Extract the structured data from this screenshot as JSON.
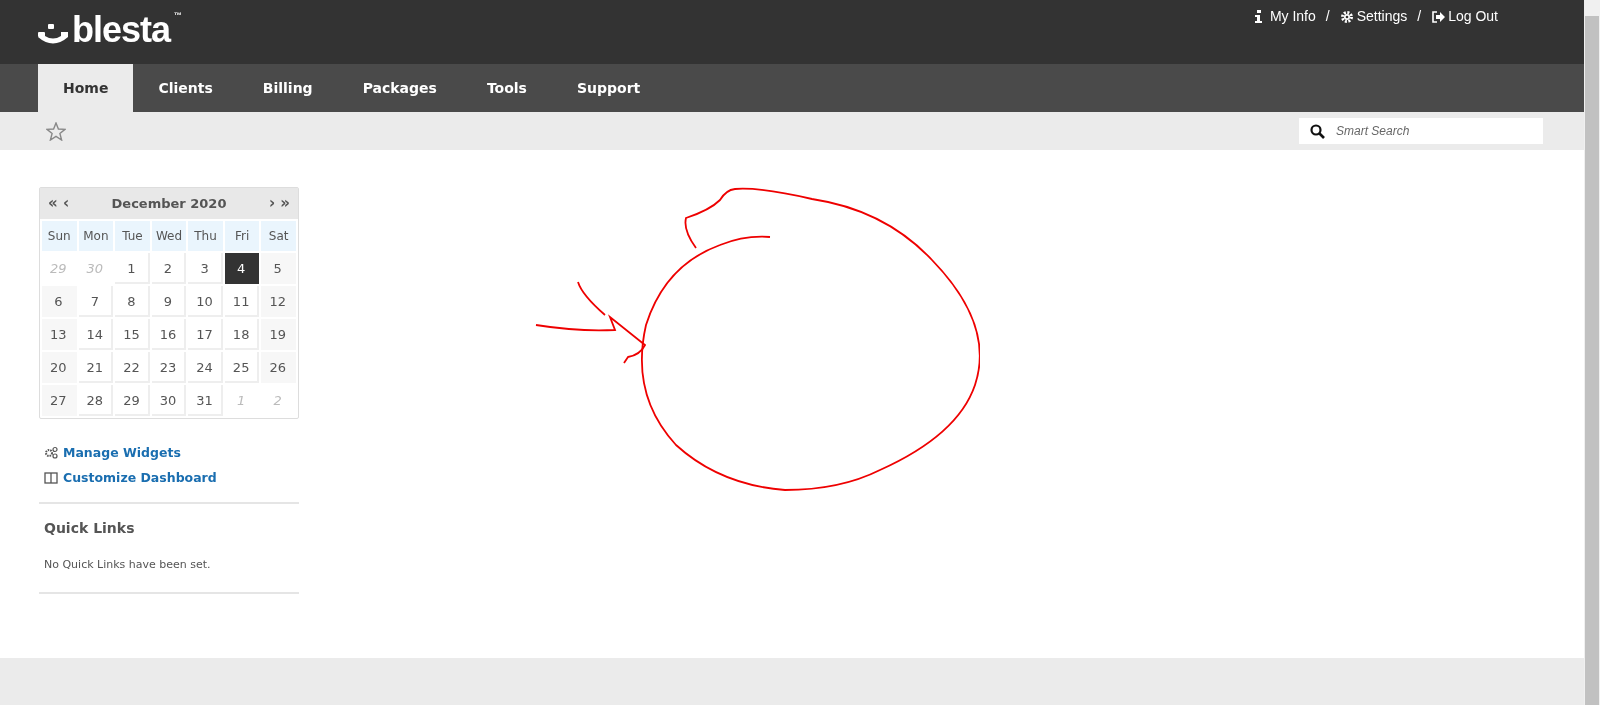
{
  "logo": {
    "text": "blesta",
    "trademark": "™"
  },
  "user_links": [
    {
      "kind": "info",
      "label": "My Info"
    },
    {
      "kind": "settings",
      "label": "Settings"
    },
    {
      "kind": "logout",
      "label": "Log Out"
    }
  ],
  "link_separator": "/",
  "nav_tabs": [
    {
      "label": "Home",
      "selected": true
    },
    {
      "label": "Clients",
      "selected": false
    },
    {
      "label": "Billing",
      "selected": false
    },
    {
      "label": "Packages",
      "selected": false
    },
    {
      "label": "Tools",
      "selected": false
    },
    {
      "label": "Support",
      "selected": false
    }
  ],
  "search": {
    "placeholder": "Smart Search"
  },
  "calendar": {
    "prev": "« ‹",
    "title": "December 2020",
    "next": "› »",
    "weekdays": [
      "Sun",
      "Mon",
      "Tue",
      "Wed",
      "Thu",
      "Fri",
      "Sat"
    ],
    "weeks": [
      [
        {
          "day": "29",
          "other_month": true,
          "selected": false
        },
        {
          "day": "30",
          "other_month": true,
          "selected": false
        },
        {
          "day": "1",
          "other_month": false,
          "selected": false
        },
        {
          "day": "2",
          "other_month": false,
          "selected": false
        },
        {
          "day": "3",
          "other_month": false,
          "selected": false
        },
        {
          "day": "4",
          "other_month": false,
          "selected": true
        },
        {
          "day": "5",
          "other_month": false,
          "selected": false
        }
      ],
      [
        {
          "day": "6",
          "other_month": false,
          "selected": false
        },
        {
          "day": "7",
          "other_month": false,
          "selected": false
        },
        {
          "day": "8",
          "other_month": false,
          "selected": false
        },
        {
          "day": "9",
          "other_month": false,
          "selected": false
        },
        {
          "day": "10",
          "other_month": false,
          "selected": false
        },
        {
          "day": "11",
          "other_month": false,
          "selected": false
        },
        {
          "day": "12",
          "other_month": false,
          "selected": false
        }
      ],
      [
        {
          "day": "13",
          "other_month": false,
          "selected": false
        },
        {
          "day": "14",
          "other_month": false,
          "selected": false
        },
        {
          "day": "15",
          "other_month": false,
          "selected": false
        },
        {
          "day": "16",
          "other_month": false,
          "selected": false
        },
        {
          "day": "17",
          "other_month": false,
          "selected": false
        },
        {
          "day": "18",
          "other_month": false,
          "selected": false
        },
        {
          "day": "19",
          "other_month": false,
          "selected": false
        }
      ],
      [
        {
          "day": "20",
          "other_month": false,
          "selected": false
        },
        {
          "day": "21",
          "other_month": false,
          "selected": false
        },
        {
          "day": "22",
          "other_month": false,
          "selected": false
        },
        {
          "day": "23",
          "other_month": false,
          "selected": false
        },
        {
          "day": "24",
          "other_month": false,
          "selected": false
        },
        {
          "day": "25",
          "other_month": false,
          "selected": false
        },
        {
          "day": "26",
          "other_month": false,
          "selected": false
        }
      ],
      [
        {
          "day": "27",
          "other_month": false,
          "selected": false
        },
        {
          "day": "28",
          "other_month": false,
          "selected": false
        },
        {
          "day": "29",
          "other_month": false,
          "selected": false
        },
        {
          "day": "30",
          "other_month": false,
          "selected": false
        },
        {
          "day": "31",
          "other_month": false,
          "selected": false
        },
        {
          "day": "1",
          "other_month": true,
          "selected": false
        },
        {
          "day": "2",
          "other_month": true,
          "selected": false
        }
      ]
    ]
  },
  "widget_links": [
    {
      "kind": "widgets",
      "label": "Manage Widgets"
    },
    {
      "kind": "dashboard",
      "label": "Customize Dashboard"
    }
  ],
  "quick_links": {
    "title": "Quick Links",
    "empty_text": "No Quick Links have been set."
  }
}
